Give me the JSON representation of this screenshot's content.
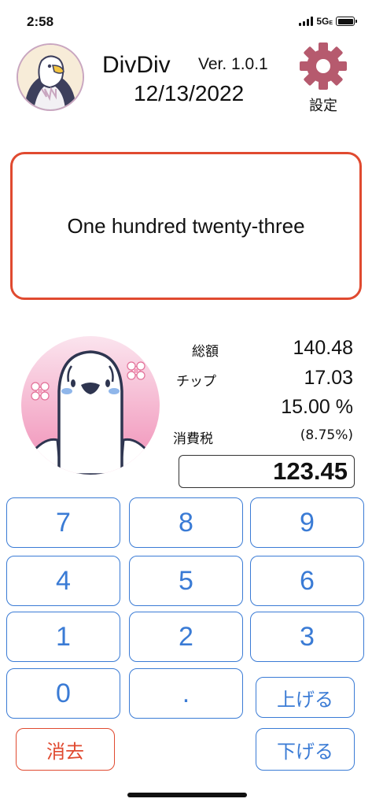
{
  "status": {
    "time": "2:58",
    "network": "5G",
    "network_suffix": "E"
  },
  "header": {
    "app_name": "DivDiv",
    "version": "Ver. 1.0.1",
    "date": "12/13/2022",
    "settings_label": "設定"
  },
  "words": {
    "text": "One hundred twenty-three"
  },
  "summary": {
    "total_label": "総額",
    "total_value": "140.48",
    "tip_label": "チップ",
    "tip_value": "17.03",
    "tip_percent": "15.00 %",
    "tax_label": "消費税",
    "tax_rate": "(8.75%)"
  },
  "display": {
    "value": "123.45"
  },
  "keypad": {
    "k7": "7",
    "k8": "8",
    "k9": "9",
    "k4": "4",
    "k5": "5",
    "k6": "6",
    "k1": "1",
    "k2": "2",
    "k3": "3",
    "k0": "0",
    "dot": ".",
    "up": "上げる",
    "down": "下げる",
    "clear": "消去"
  },
  "colors": {
    "accent": "#3a7bd5",
    "alert": "#e04a30",
    "gear": "#b65a6e",
    "bird_bg": "#f4b8cf"
  }
}
